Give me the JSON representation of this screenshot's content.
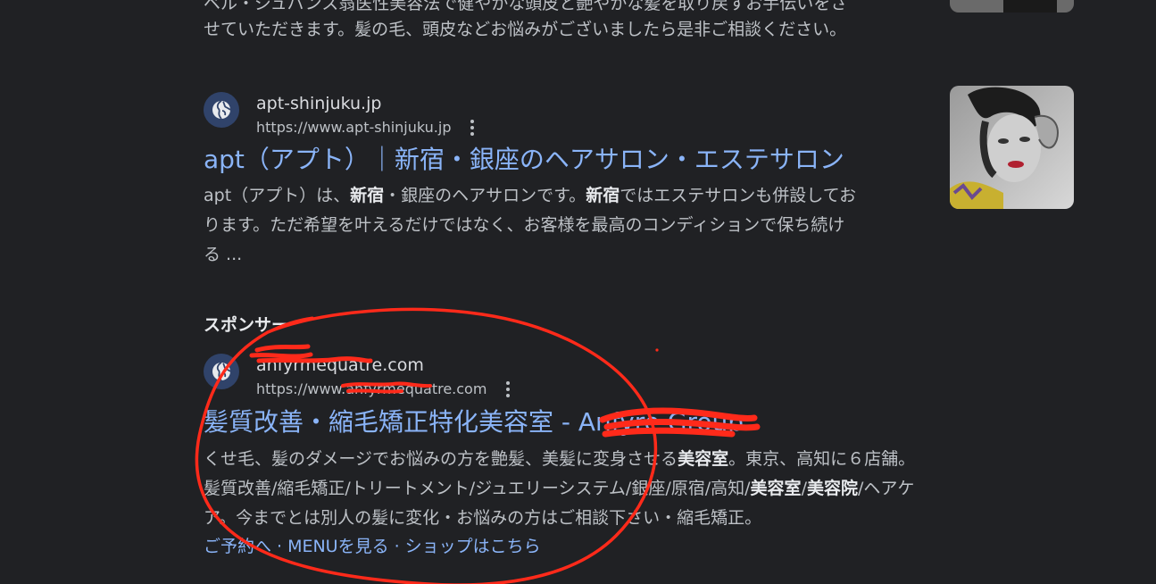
{
  "prev_result": {
    "snippet_partial": "ベル・ジュバンス翁医性美容法で健やかな頭皮と艶やかな髪を取り戻すお手伝いをさ",
    "snippet_line": "せていただきます。髪の毛、頭皮などお悩みがございましたら是非ご相談ください。"
  },
  "result1": {
    "site_name": "apt-shinjuku.jp",
    "url": "https://www.apt-shinjuku.jp",
    "title": "apt（アプト）｜新宿・銀座のヘアサロン・エステサロン",
    "snippet": {
      "l1a": "apt（アプト）は、",
      "l1b": "新宿",
      "l1c": "・銀座のヘアサロンです。",
      "l1d": "新宿",
      "l1e": "ではエステサロンも併設してお",
      "l2": "ります。ただ希望を叶えるだけではなく、お客様を最高のコンディションで保ち続け",
      "l3": "る ..."
    }
  },
  "sponsored_label": "スポンサー",
  "ad": {
    "site_name": "anfyrmequatre.com",
    "url": "https://www.anfyrmequatre.com",
    "title": "髪質改善・縮毛矯正特化美容室 - Anfyre Group",
    "snippet": {
      "l1a": "くせ毛、髪のダメージでお悩みの方を艶髪、美髪に変身させる",
      "l1b": "美容室",
      "l1c": "。東京、高知に６店舗。",
      "l2a": "髪質改善/縮毛矯正/トリートメント/ジュエリーシステム/銀座/原宿/高知/",
      "l2b": "美容室",
      "l2c": "/",
      "l2d": "美容院",
      "l2e": "/ヘアケ",
      "l3": "ア。今までとは別人の髪に変化・お悩みの方はご相談下さい・縮毛矯正。"
    },
    "sitelinks": [
      "ご予約へ",
      "MENUを見る",
      "ショップはこちら"
    ]
  },
  "icons": {
    "favicon": "globe-icon",
    "more": "more-vert-icon"
  },
  "colors": {
    "background": "#202124",
    "link": "#8ab4f8",
    "annotation": "#ff2a1a"
  }
}
